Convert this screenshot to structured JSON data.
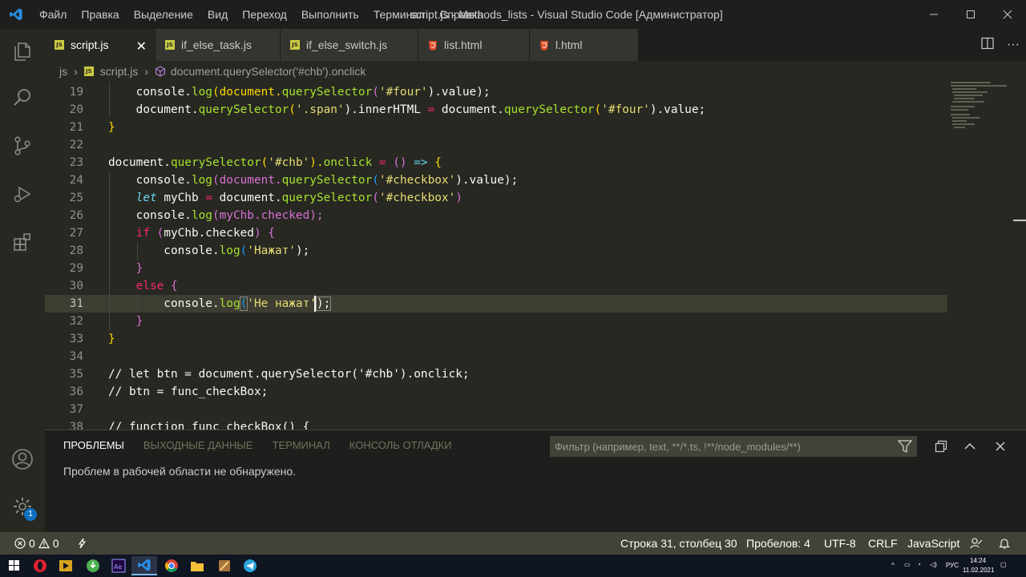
{
  "titlebar": {
    "menu": [
      "Файл",
      "Правка",
      "Выделение",
      "Вид",
      "Переход",
      "Выполнить",
      "Терминал",
      "Справка"
    ],
    "title": "script.js - Methods_lists - Visual Studio Code [Администратор]",
    "icons": [
      "vscode-logo-icon",
      "minimize-icon",
      "maximize-icon",
      "close-icon"
    ]
  },
  "tabs": [
    {
      "label": "script.js",
      "icon": "js-file-icon",
      "active": true
    },
    {
      "label": "if_else_task.js",
      "icon": "js-file-icon",
      "active": false
    },
    {
      "label": "if_else_switch.js",
      "icon": "js-file-icon",
      "active": false
    },
    {
      "label": "list.html",
      "icon": "html5-file-icon",
      "active": false
    },
    {
      "label": "l.html",
      "icon": "html5-file-icon",
      "active": false
    }
  ],
  "breadcrumb": {
    "folder": "js",
    "file": "script.js",
    "symbol": "document.querySelector('#chb').onclick"
  },
  "editor": {
    "current_line": 31,
    "lines": [
      {
        "n": "19"
      },
      {
        "n": "20"
      },
      {
        "n": "21"
      },
      {
        "n": "22"
      },
      {
        "n": "23"
      },
      {
        "n": "24"
      },
      {
        "n": "25"
      },
      {
        "n": "26"
      },
      {
        "n": "27"
      },
      {
        "n": "28"
      },
      {
        "n": "29"
      },
      {
        "n": "30"
      },
      {
        "n": "31"
      },
      {
        "n": "32"
      },
      {
        "n": "33"
      },
      {
        "n": "34"
      },
      {
        "n": "35"
      },
      {
        "n": "36"
      },
      {
        "n": "37"
      },
      {
        "n": "38"
      }
    ],
    "code": {
      "l19_a": "    console.",
      "l19_b": "log",
      "l19_c": "(document.",
      "l19_d": "querySelector",
      "l19_e": "(",
      "l19_f": "'#four'",
      "l19_g": ").value);",
      "l20_a": "    document.",
      "l20_b": "querySelector",
      "l20_c": "(",
      "l20_d": "'.span'",
      "l20_e": ").innerHTML ",
      "l20_f": "=",
      "l20_g": " document.",
      "l20_h": "querySelector",
      "l20_i": "(",
      "l20_j": "'#four'",
      "l20_k": ").value;",
      "l21_a": "}",
      "l23_a": "document.",
      "l23_b": "querySelector",
      "l23_c": "(",
      "l23_d": "'#chb'",
      "l23_e": ").",
      "l23_f": "onclick",
      "l23_g": " = ",
      "l23_h": "()",
      "l23_i": " => ",
      "l23_j": "{",
      "l24_a": "    console.",
      "l24_b": "log",
      "l24_c": "(document.",
      "l24_d": "querySelector",
      "l24_e": "(",
      "l24_f": "'#checkbox'",
      "l24_g": ").value);",
      "l25_a": "    ",
      "l25_b": "let",
      "l25_c": " myChb ",
      "l25_d": "=",
      "l25_e": " document.",
      "l25_f": "querySelector",
      "l25_g": "(",
      "l25_h": "'#checkbox'",
      "l25_i": ")",
      "l26_a": "    console.",
      "l26_b": "log",
      "l26_c": "(myChb.checked);",
      "l27_a": "    ",
      "l27_b": "if",
      "l27_c": " ",
      "l27_d": "(",
      "l27_e": "myChb.checked",
      "l27_f": ")",
      "l27_g": " ",
      "l27_h": "{",
      "l28_a": "        console.",
      "l28_b": "log",
      "l28_c": "(",
      "l28_d": "'Нажат'",
      "l28_e": ");",
      "l29_a": "    ",
      "l29_b": "}",
      "l30_a": "    ",
      "l30_b": "else",
      "l30_c": " ",
      "l30_d": "{",
      "l31_a": "        console.",
      "l31_b": "log",
      "l31_c": "(",
      "l31_d": "'Не нажат",
      "l31_e": "'",
      "l31_f": ");",
      "l32_a": "    ",
      "l32_b": "}",
      "l33_a": "}",
      "l35_a": "// let btn = document.querySelector('#chb').onclick;",
      "l36_a": "// btn = func_checkBox;",
      "l38_a": "// function func_checkBox() {"
    }
  },
  "panel": {
    "tabs": [
      "ПРОБЛЕМЫ",
      "ВЫХОДНЫЕ ДАННЫЕ",
      "ТЕРМИНАЛ",
      "КОНСОЛЬ ОТЛАДКИ"
    ],
    "filter_placeholder": "Фильтр (например, text, **/*.ts, !**/node_modules/**)",
    "message": "Проблем в рабочей области не обнаружено."
  },
  "activity": {
    "icons": [
      "explorer-icon",
      "search-icon",
      "source-control-icon",
      "run-debug-icon",
      "extensions-icon",
      "account-icon",
      "settings-gear-icon"
    ],
    "settings_badge": "1"
  },
  "statusbar": {
    "errors": "0",
    "warnings": "0",
    "position": "Строка 31, столбец 30",
    "spaces": "Пробелов: 4",
    "encoding": "UTF-8",
    "eol": "CRLF",
    "language": "JavaScript"
  },
  "taskbar": {
    "lang": "РУС",
    "time": "14:24",
    "date": "11.02.2021"
  },
  "colors": {
    "keyword": "#f92672",
    "string": "#e6db74",
    "function": "#a6e22e",
    "storage": "#66d9ef",
    "comment": "#88846f",
    "background": "#272822"
  }
}
